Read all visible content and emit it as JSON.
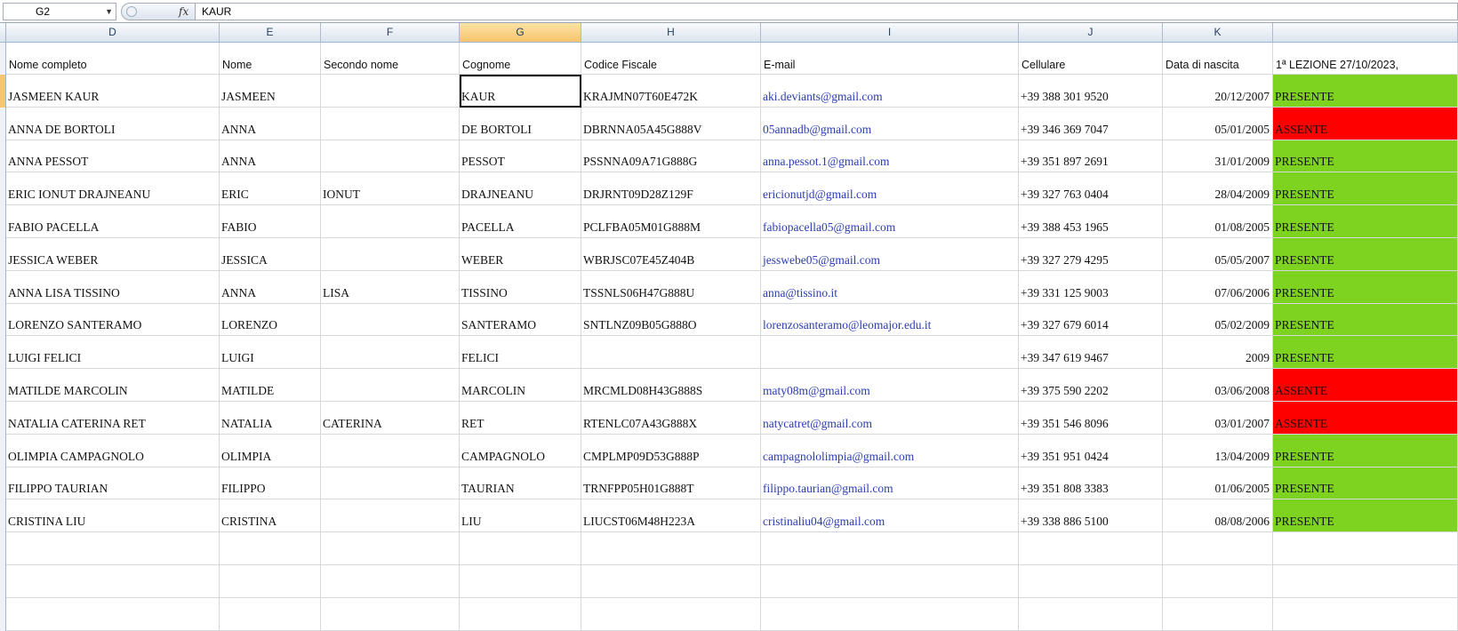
{
  "formula_bar": {
    "name_box": "G2",
    "fx_label": "fx",
    "value": "KAUR"
  },
  "columns": [
    "D",
    "E",
    "F",
    "G",
    "H",
    "I",
    "J",
    "K",
    ""
  ],
  "headers": [
    "Nome completo",
    "Nome",
    "Secondo nome",
    "Cognome",
    "Codice Fiscale",
    "E-mail",
    "Cellulare",
    "Data di nascita",
    "1ª LEZIONE 27/10/2023,"
  ],
  "rows": [
    {
      "full": "JASMEEN KAUR",
      "first": "JASMEEN",
      "middle": "",
      "last": "KAUR",
      "cf": "KRAJMN07T60E472K",
      "email": "aki.deviants@gmail.com",
      "phone": "+39 388 301 9520",
      "dob": "20/12/2007",
      "status": "PRESENTE"
    },
    {
      "full": "ANNA DE BORTOLI",
      "first": "ANNA",
      "middle": "",
      "last": "DE BORTOLI",
      "cf": "DBRNNA05A45G888V",
      "email": "05annadb@gmail.com",
      "phone": "+39 346 369 7047",
      "dob": "05/01/2005",
      "status": "ASSENTE"
    },
    {
      "full": "ANNA PESSOT",
      "first": "ANNA",
      "middle": "",
      "last": "PESSOT",
      "cf": "PSSNNA09A71G888G",
      "email": "anna.pessot.1@gmail.com",
      "phone": "+39 351 897 2691",
      "dob": "31/01/2009",
      "status": "PRESENTE"
    },
    {
      "full": "ERIC IONUT DRAJNEANU",
      "first": "ERIC",
      "middle": "IONUT",
      "last": "DRAJNEANU",
      "cf": "DRJRNT09D28Z129F",
      "email": "ericionutjd@gmail.com",
      "phone": "+39 327 763 0404",
      "dob": "28/04/2009",
      "status": "PRESENTE"
    },
    {
      "full": "FABIO PACELLA",
      "first": "FABIO",
      "middle": "",
      "last": "PACELLA",
      "cf": "PCLFBA05M01G888M",
      "email": "fabiopacella05@gmail.com",
      "phone": "+39 388 453 1965",
      "dob": "01/08/2005",
      "status": "PRESENTE"
    },
    {
      "full": "JESSICA WEBER",
      "first": "JESSICA",
      "middle": "",
      "last": "WEBER",
      "cf": "WBRJSC07E45Z404B",
      "email": "jesswebe05@gmail.com",
      "phone": "+39 327 279 4295",
      "dob": "05/05/2007",
      "status": "PRESENTE"
    },
    {
      "full": "ANNA LISA TISSINO",
      "first": "ANNA",
      "middle": "LISA",
      "last": "TISSINO",
      "cf": "TSSNLS06H47G888U",
      "email": "anna@tissino.it",
      "phone": "+39 331 125 9003",
      "dob": "07/06/2006",
      "status": "PRESENTE"
    },
    {
      "full": "LORENZO SANTERAMO",
      "first": "LORENZO",
      "middle": "",
      "last": "SANTERAMO",
      "cf": "SNTLNZ09B05G888O",
      "email": "lorenzosanteramo@leomajor.edu.it",
      "phone": "+39 327 679 6014",
      "dob": "05/02/2009",
      "status": "PRESENTE"
    },
    {
      "full": "LUIGI FELICI",
      "first": "LUIGI",
      "middle": "",
      "last": "FELICI",
      "cf": "",
      "email": "",
      "phone": "+39 347 619 9467",
      "dob": "2009",
      "status": "PRESENTE"
    },
    {
      "full": "MATILDE MARCOLIN",
      "first": "MATILDE",
      "middle": "",
      "last": "MARCOLIN",
      "cf": "MRCMLD08H43G888S",
      "email": "maty08m@gmail.com",
      "phone": "+39 375 590 2202",
      "dob": "03/06/2008",
      "status": "ASSENTE"
    },
    {
      "full": "NATALIA CATERINA RET",
      "first": "NATALIA",
      "middle": "CATERINA",
      "last": "RET",
      "cf": "RTENLC07A43G888X",
      "email": "natycatret@gmail.com",
      "phone": "+39 351 546 8096",
      "dob": "03/01/2007",
      "status": "ASSENTE"
    },
    {
      "full": "OLIMPIA CAMPAGNOLO",
      "first": "OLIMPIA",
      "middle": "",
      "last": "CAMPAGNOLO",
      "cf": "CMPLMP09D53G888P",
      "email": "campagnololimpia@gmail.com",
      "phone": "+39 351 951 0424",
      "dob": "13/04/2009",
      "status": "PRESENTE"
    },
    {
      "full": "FILIPPO TAURIAN",
      "first": "FILIPPO",
      "middle": "",
      "last": "TAURIAN",
      "cf": "TRNFPP05H01G888T",
      "email": "filippo.taurian@gmail.com",
      "phone": "+39 351 808 3383",
      "dob": "01/06/2005",
      "status": "PRESENTE"
    },
    {
      "full": "CRISTINA LIU",
      "first": "CRISTINA",
      "middle": "",
      "last": "LIU",
      "cf": "LIUCST06M48H223A",
      "email": "cristinaliu04@gmail.com",
      "phone": "+39 338 886 5100",
      "dob": "08/08/2006",
      "status": "PRESENTE"
    }
  ],
  "selected_column": "G",
  "status_colors": {
    "PRESENTE": "#7ed321",
    "ASSENTE": "#ff0000"
  }
}
